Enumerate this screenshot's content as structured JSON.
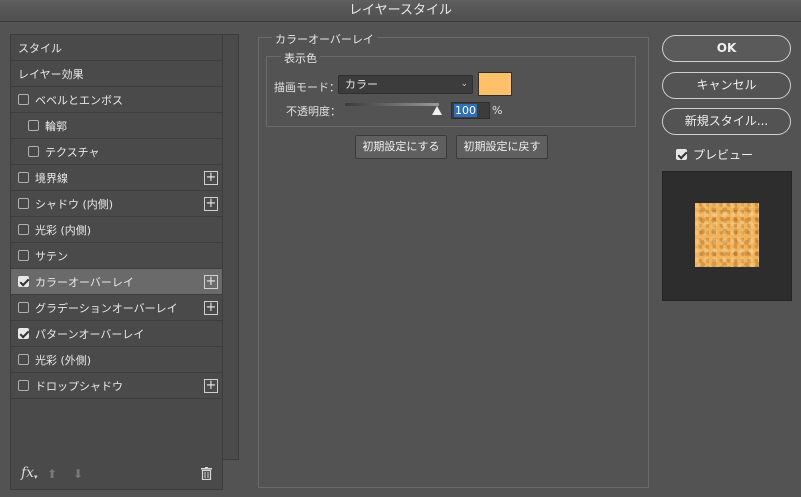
{
  "window": {
    "title": "レイヤースタイル"
  },
  "styles_list": [
    {
      "label": "スタイル",
      "checkbox": false,
      "checked": false,
      "indent": 0,
      "plus": false,
      "selected": false
    },
    {
      "label": "レイヤー効果",
      "checkbox": false,
      "checked": false,
      "indent": 0,
      "plus": false,
      "selected": false
    },
    {
      "label": "ベベルとエンボス",
      "checkbox": true,
      "checked": false,
      "indent": 0,
      "plus": false,
      "selected": false
    },
    {
      "label": "輪郭",
      "checkbox": true,
      "checked": false,
      "indent": 1,
      "plus": false,
      "selected": false
    },
    {
      "label": "テクスチャ",
      "checkbox": true,
      "checked": false,
      "indent": 1,
      "plus": false,
      "selected": false
    },
    {
      "label": "境界線",
      "checkbox": true,
      "checked": false,
      "indent": 0,
      "plus": true,
      "selected": false
    },
    {
      "label": "シャドウ (内側)",
      "checkbox": true,
      "checked": false,
      "indent": 0,
      "plus": true,
      "selected": false
    },
    {
      "label": "光彩 (内側)",
      "checkbox": true,
      "checked": false,
      "indent": 0,
      "plus": false,
      "selected": false
    },
    {
      "label": "サテン",
      "checkbox": true,
      "checked": false,
      "indent": 0,
      "plus": false,
      "selected": false
    },
    {
      "label": "カラーオーバーレイ",
      "checkbox": true,
      "checked": true,
      "indent": 0,
      "plus": true,
      "selected": true
    },
    {
      "label": "グラデーションオーバーレイ",
      "checkbox": true,
      "checked": false,
      "indent": 0,
      "plus": true,
      "selected": false
    },
    {
      "label": "パターンオーバーレイ",
      "checkbox": true,
      "checked": true,
      "indent": 0,
      "plus": false,
      "selected": false
    },
    {
      "label": "光彩 (外側)",
      "checkbox": true,
      "checked": false,
      "indent": 0,
      "plus": false,
      "selected": false
    },
    {
      "label": "ドロップシャドウ",
      "checkbox": true,
      "checked": false,
      "indent": 0,
      "plus": true,
      "selected": false
    }
  ],
  "footer": {
    "fx_label": "fx"
  },
  "overlay": {
    "section_title": "カラーオーバーレイ",
    "group_title": "表示色",
    "blend_mode_label": "描画モード：",
    "blend_mode_value": "カラー",
    "color": "#ffc06a",
    "opacity_label": "不透明度：",
    "opacity_value": "100",
    "opacity_unit": "%",
    "opacity_level": 1.0,
    "reset_default_button": "初期設定にする",
    "restore_default_button": "初期設定に戻す"
  },
  "actions": {
    "ok": "OK",
    "cancel": "キャンセル",
    "new_style": "新規スタイル..."
  },
  "preview": {
    "label": "プレビュー",
    "checked": true,
    "swatch_color": "#f2b45a"
  }
}
